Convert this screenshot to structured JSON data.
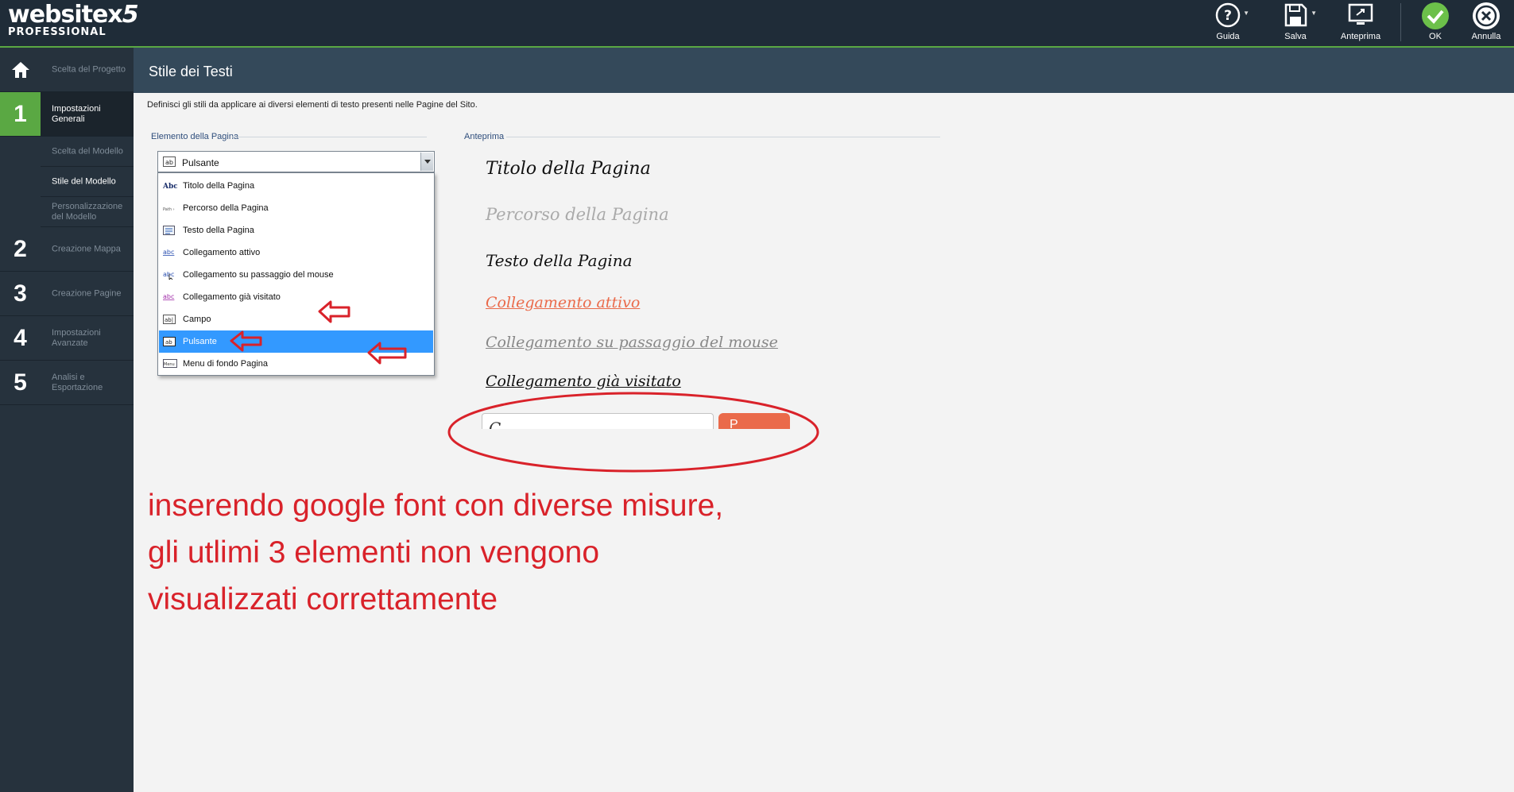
{
  "app": {
    "logo_main": "websitex",
    "logo_x5": "5",
    "logo_sub": "PROFESSIONAL"
  },
  "toolbar": {
    "help_label": "Guida",
    "save_label": "Salva",
    "preview_label": "Anteprima",
    "ok_label": "OK",
    "cancel_label": "Annulla"
  },
  "sidebar": {
    "home_step": {
      "label": "Scelta del Progetto"
    },
    "steps": [
      {
        "num": "1",
        "label": "Impostazioni Generali",
        "active": true
      },
      {
        "num": "2",
        "label": "Creazione Mappa"
      },
      {
        "num": "3",
        "label": "Creazione Pagine"
      },
      {
        "num": "4",
        "label": "Impostazioni Avanzate"
      },
      {
        "num": "5",
        "label": "Analisi e Esportazione"
      }
    ],
    "substeps": [
      {
        "label": "Scelta del Modello"
      },
      {
        "label": "Stile del Modello",
        "current": true
      },
      {
        "label": "Personalizzazione del Modello"
      }
    ]
  },
  "page": {
    "title": "Stile dei Testi",
    "intro": "Definisci gli stili da applicare ai diversi elementi di testo presenti nelle Pagine del Sito."
  },
  "element_section": {
    "label": "Elemento della Pagina",
    "selected": "Pulsante",
    "options": [
      {
        "label": "Titolo della Pagina",
        "icon": "title-style-icon",
        "icon_text": "Abc"
      },
      {
        "label": "Percorso della Pagina",
        "icon": "path-style-icon",
        "icon_text": "Path ›"
      },
      {
        "label": "Testo della Pagina",
        "icon": "text-style-icon"
      },
      {
        "label": "Collegamento attivo",
        "icon": "link-style-icon",
        "icon_text": "abc"
      },
      {
        "label": "Collegamento su passaggio del mouse",
        "icon": "hover-link-style-icon",
        "icon_text": "abc"
      },
      {
        "label": "Collegamento già visitato",
        "icon": "visited-link-style-icon",
        "icon_text": "abc"
      },
      {
        "label": "Campo",
        "icon": "field-style-icon",
        "icon_text": "ab|"
      },
      {
        "label": "Pulsante",
        "icon": "button-style-icon",
        "icon_text": "ab",
        "selected": true
      },
      {
        "label": "Menu di fondo Pagina",
        "icon": "footer-menu-style-icon",
        "icon_text": "Menu"
      }
    ]
  },
  "preview_section": {
    "label": "Anteprima",
    "items": {
      "title": "Titolo della Pagina",
      "path": "Percorso della Pagina",
      "text": "Testo della Pagina",
      "link": "Collegamento attivo",
      "hover": "Collegamento su passaggio del mouse",
      "visited": "Collegamento già visitato"
    },
    "field_partial": "C",
    "button_partial": "P"
  },
  "annotation": {
    "text": "inserendo google font con diverse misure, gli utlimi 3 elementi non vengono visualizzati correttamente",
    "color": "#d9222a"
  },
  "colors": {
    "accent": "#5aa843",
    "header": "#34495a",
    "topbar": "#1f2c38",
    "sidebar": "#26323d",
    "selection": "#3399ff",
    "link": "#ea6a4a"
  }
}
